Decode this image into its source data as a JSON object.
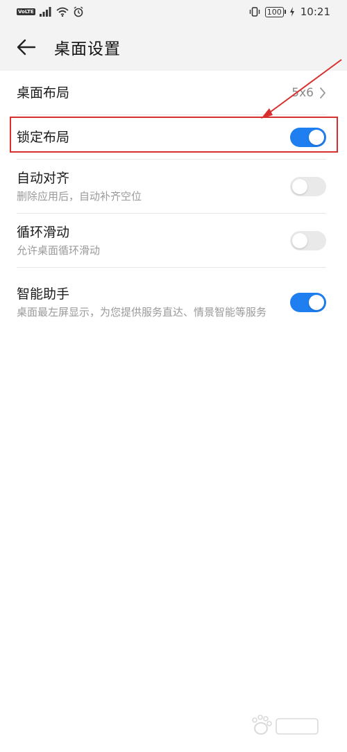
{
  "status": {
    "volte": "VoLTE",
    "battery": "100",
    "time": "10:21"
  },
  "header": {
    "title": "桌面设置"
  },
  "settings": {
    "layout": {
      "title": "桌面布局",
      "value": "5x6"
    },
    "lock_layout": {
      "title": "锁定布局",
      "enabled": true
    },
    "auto_align": {
      "title": "自动对齐",
      "subtitle": "删除应用后，自动补齐空位",
      "enabled": false
    },
    "loop_scroll": {
      "title": "循环滑动",
      "subtitle": "允许桌面循环滑动",
      "enabled": false
    },
    "smart_assistant": {
      "title": "智能助手",
      "subtitle": "桌面最左屏显示，为您提供服务直达、情景智能等服务",
      "enabled": true
    }
  },
  "colors": {
    "accent": "#1f7ef0",
    "annotation": "#d92e2e",
    "header_bg": "#f3f3f3"
  }
}
